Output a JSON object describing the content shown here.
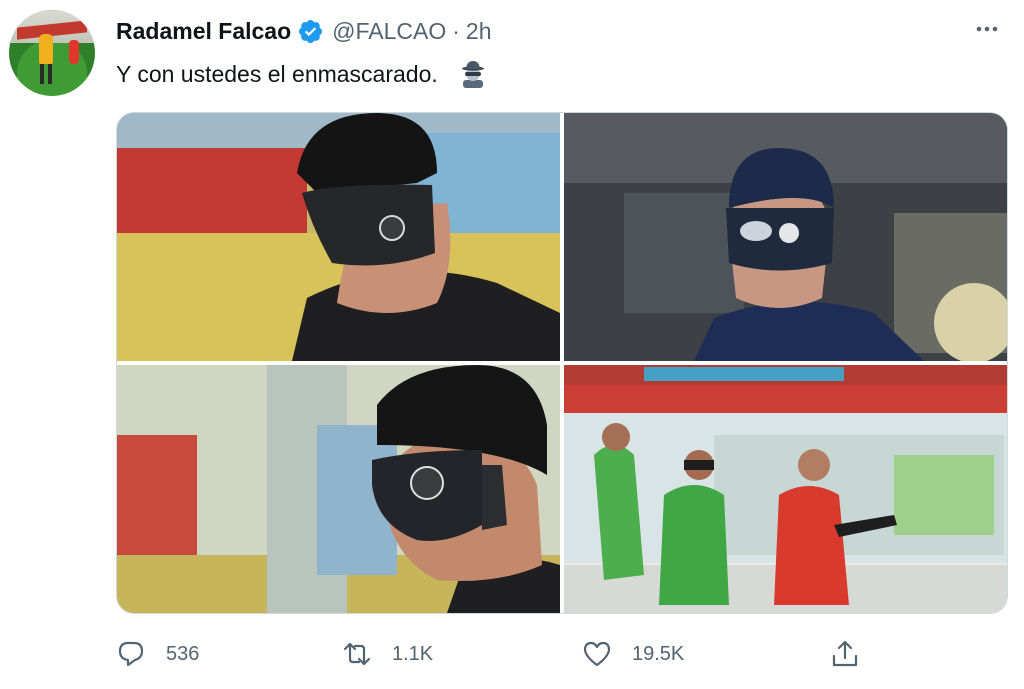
{
  "tweet": {
    "author_name": "Radamel Falcao",
    "handle": "@FALCAO",
    "separator": "·",
    "time": "2h",
    "text": "Y con ustedes el enmascarado.",
    "emoji_icon": "spy-emoji-icon"
  },
  "media": {
    "photos": [
      {
        "alt_icon": "player-mask-photo-1"
      },
      {
        "alt_icon": "player-mask-photo-2"
      },
      {
        "alt_icon": "player-mask-photo-3"
      },
      {
        "alt_icon": "training-photo-4"
      }
    ]
  },
  "actions": {
    "reply_count": "536",
    "retweet_count": "1.1K",
    "like_count": "19.5K"
  },
  "colors": {
    "verified": "#1d9bf0",
    "secondary_text": "#536471",
    "border": "#cfd9de"
  }
}
